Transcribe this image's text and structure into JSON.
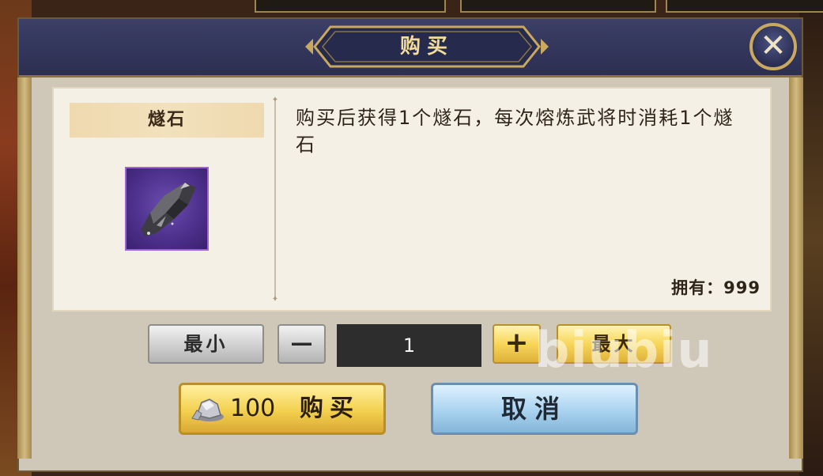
{
  "dialog": {
    "title": "购买",
    "close_icon": "close-x-icon"
  },
  "item": {
    "name": "燧石",
    "icon": "flint-stone-icon",
    "description": "购买后获得1个燧石，每次熔炼武将时消耗1个燧石",
    "owned_label": "拥有：999"
  },
  "quantity": {
    "min_label": "最小",
    "decrease_symbol": "—",
    "value": "1",
    "increase_symbol": "+",
    "max_label": "最大"
  },
  "actions": {
    "buy_price": "100",
    "buy_label": "购买",
    "cancel_label": "取消",
    "currency_icon": "silver-ingot-icon"
  },
  "watermark": "biubiu",
  "colors": {
    "header_bg": "#2c2f52",
    "title_text": "#f3dc9a",
    "gold_button": "#f3d04e",
    "blue_button": "#a9d3ef",
    "item_frame": "#9b63d6"
  }
}
